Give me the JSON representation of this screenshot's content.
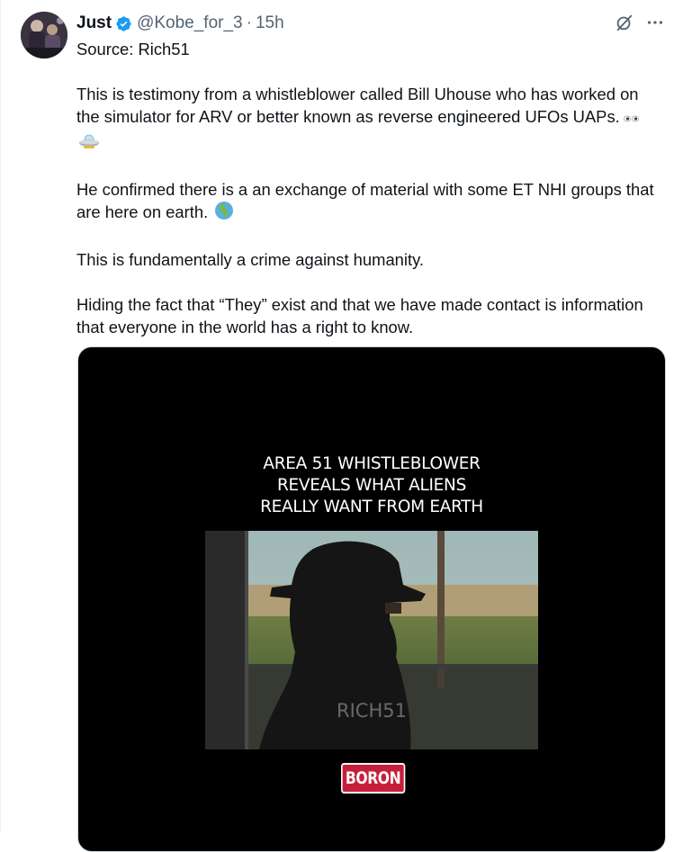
{
  "tweet": {
    "author": {
      "display_name": "Just",
      "handle": "@Kobe_for_3",
      "verified": true
    },
    "separator": "·",
    "time": "15h",
    "paragraphs": [
      "Source: Rich51",
      "This is testimony from a whistleblower called Bill Uhouse who has worked on the simulator for ARV or better known as reverse  engineered UFOs UAPs.",
      "He confirmed there is a an exchange of material with some ET NHI groups that are here on earth.",
      "This is fundamentally a crime against humanity.",
      "Hiding the fact that “They” exist and that we have made contact is information that everyone in the world has a right to know."
    ],
    "emojis": {
      "p2": [
        "eyes-emoji",
        "flying-saucer-emoji"
      ],
      "p3": [
        "globe-africa-emoji"
      ]
    }
  },
  "media": {
    "video_title_lines": [
      "AREA 51 WHISTLEBLOWER",
      "REVEALS WHAT ALIENS",
      "REALLY WANT FROM EARTH"
    ],
    "watermark": "RICH51",
    "brand": "BORON"
  },
  "icons": {
    "verified": "verified-badge-icon",
    "grok": "grok-icon",
    "more": "more-icon"
  },
  "colors": {
    "text": "#0f1419",
    "secondary_text": "#536471",
    "verified": "#1d9bf0",
    "brand_badge": "#c61f3a"
  }
}
